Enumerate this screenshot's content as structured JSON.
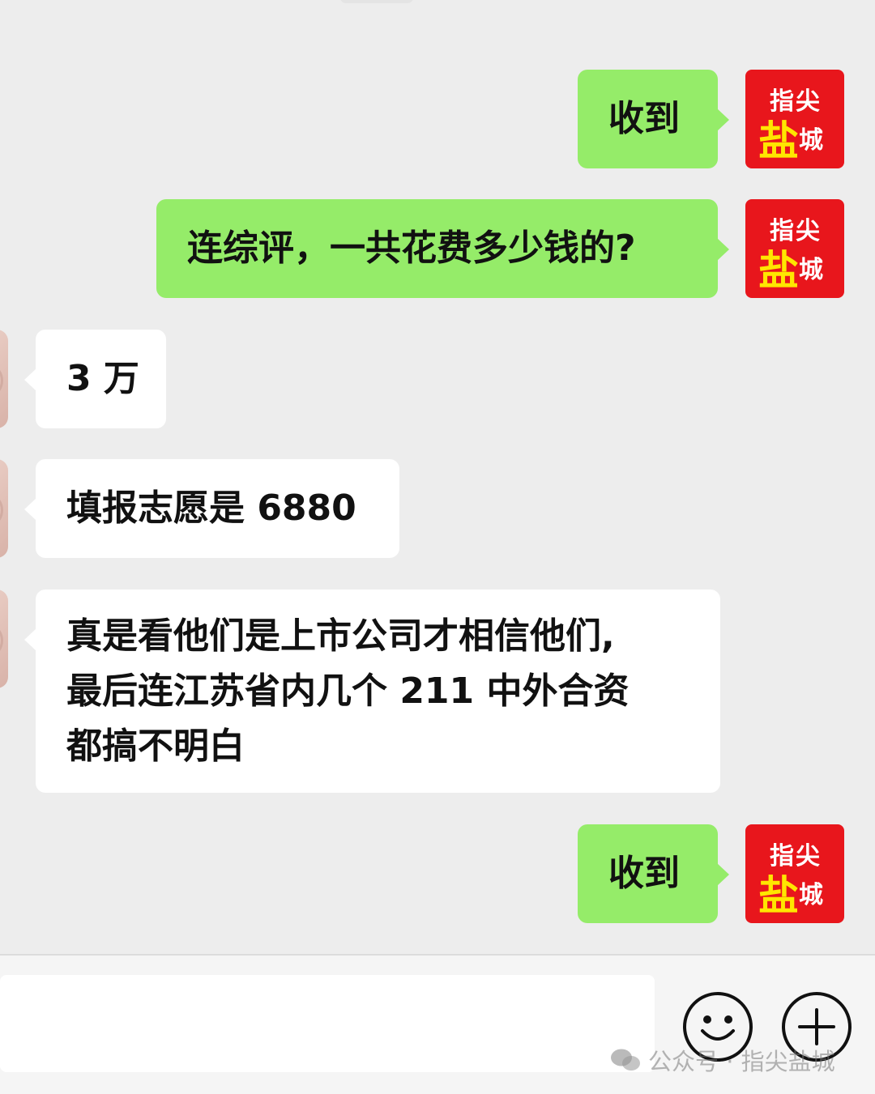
{
  "messages": [
    {
      "direction": "out",
      "text": "收到"
    },
    {
      "direction": "out",
      "text": "连综评，一共花费多少钱的?"
    },
    {
      "direction": "in",
      "text": "3 万"
    },
    {
      "direction": "in",
      "text": "填报志愿是 6880"
    },
    {
      "direction": "in",
      "lines": [
        "真是看他们是上市公司才相信他们,",
        "最后连江苏省内几个 211 中外合资",
        "都搞不明白"
      ]
    },
    {
      "direction": "out",
      "text": "收到"
    }
  ],
  "self_avatar": {
    "line1": "指尖",
    "big": "盐",
    "small": "城"
  },
  "input": {
    "value": "",
    "placeholder": ""
  },
  "icons": {
    "emoji": "smiley-face-icon",
    "more": "plus-circle-icon",
    "watermark": "wechat-logo-icon"
  },
  "watermark": {
    "text": "公众号 · 指尖盐城"
  },
  "colors": {
    "background": "#ededed",
    "outgoing_bubble": "#95ec69",
    "incoming_bubble": "#ffffff",
    "avatar_red": "#e8161c",
    "avatar_yellow": "#ffe600"
  }
}
